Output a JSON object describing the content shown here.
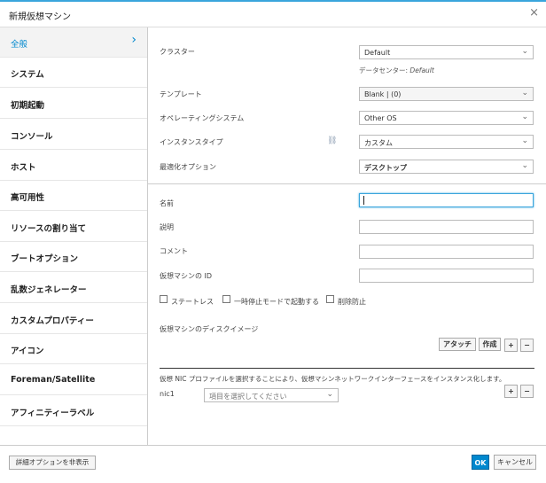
{
  "dialog": {
    "title": "新規仮想マシン",
    "close_glyph": "×"
  },
  "sidebar": {
    "items": [
      {
        "label": "全般"
      },
      {
        "label": "システム"
      },
      {
        "label": "初期起動"
      },
      {
        "label": "コンソール"
      },
      {
        "label": "ホスト"
      },
      {
        "label": "高可用性"
      },
      {
        "label": "リソースの割り当て"
      },
      {
        "label": "ブートオプション"
      },
      {
        "label": "乱数ジェネレーター"
      },
      {
        "label": "カスタムプロパティー"
      },
      {
        "label": "アイコン"
      },
      {
        "label": "Foreman/Satellite"
      },
      {
        "label": "アフィニティーラベル"
      }
    ],
    "active_chevron": "›"
  },
  "form": {
    "cluster": {
      "label": "クラスター",
      "value": "Default",
      "datacenter_prefix": "データセンター: ",
      "datacenter_value": "Default"
    },
    "template": {
      "label": "テンプレート",
      "value": "Blank |  (0)"
    },
    "os": {
      "label": "オペレーティングシステム",
      "value": "Other OS"
    },
    "instance_type": {
      "label": "インスタンスタイプ",
      "value": "カスタム",
      "link_icon": "link-icon"
    },
    "optimize": {
      "label": "最適化オプション",
      "value": "デスクトップ"
    },
    "name": {
      "label": "名前",
      "value": ""
    },
    "description": {
      "label": "説明",
      "value": ""
    },
    "comment": {
      "label": "コメント",
      "value": ""
    },
    "vm_id": {
      "label": "仮想マシンの ID",
      "value": ""
    },
    "checkboxes": {
      "stateless": "ステートレス",
      "paused": "一時停止モードで起動する",
      "delete_protect": "削除防止"
    },
    "disk": {
      "label": "仮想マシンのディスクイメージ",
      "attach": "アタッチ",
      "create": "作成",
      "plus": "+",
      "minus": "−"
    },
    "nic": {
      "note": "仮想 NIC プロファイルを選択することにより、仮想マシンネットワークインターフェースをインスタンス化します。",
      "label": "nic1",
      "placeholder": "項目を選択してください",
      "plus": "+",
      "minus": "−"
    }
  },
  "footer": {
    "advanced": "詳細オプションを非表示",
    "ok": "OK",
    "cancel": "キャンセル"
  },
  "colors": {
    "accent": "#0088ce",
    "topbar": "#39a5dc"
  }
}
